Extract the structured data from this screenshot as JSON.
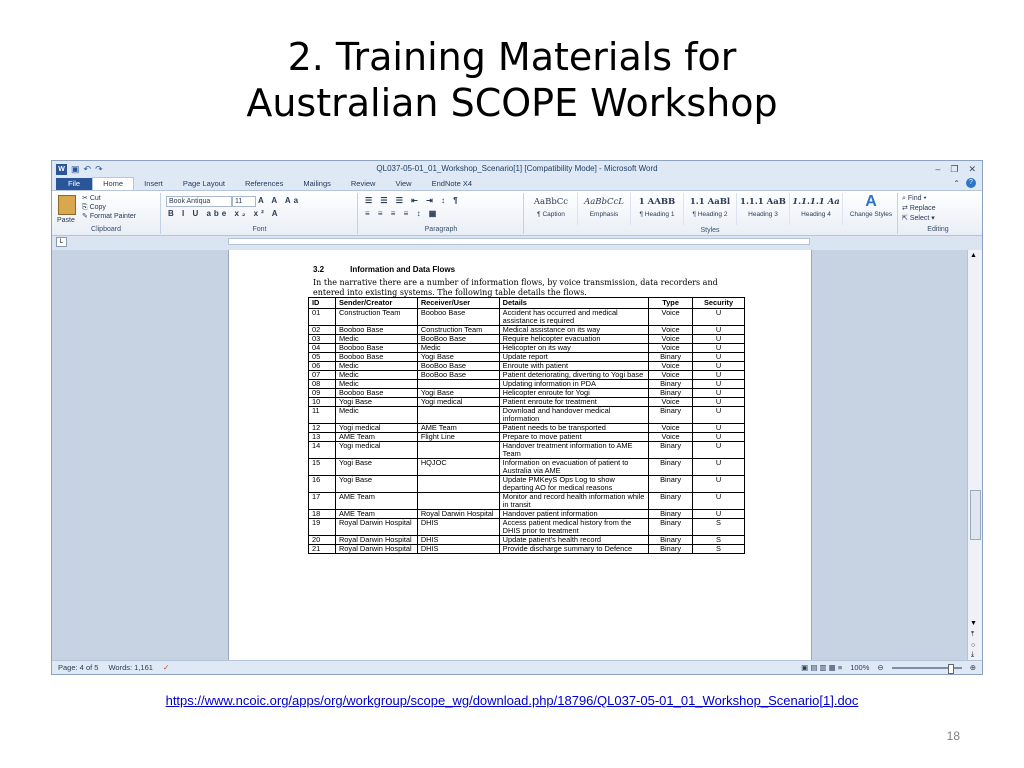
{
  "slide": {
    "title_line1": "2. Training Materials for",
    "title_line2": "Australian SCOPE Workshop",
    "link": "https://www.ncoic.org/apps/org/workgroup/scope_wg/download.php/18796/QL037-05-01_01_Workshop_Scenario[1].doc",
    "page_number": "18"
  },
  "window": {
    "title": "QL037-05-01_01_Workshop_Scenario[1] [Compatibility Mode] - Microsoft Word",
    "icon": "word-icon",
    "tabs": [
      "File",
      "Home",
      "Insert",
      "Page Layout",
      "References",
      "Mailings",
      "Review",
      "View",
      "EndNote X4"
    ],
    "active_tab": "Home"
  },
  "ribbon": {
    "clipboard": {
      "paste": "Paste",
      "cut": "Cut",
      "copy": "Copy",
      "format_painter": "Format Painter",
      "label": "Clipboard"
    },
    "font": {
      "name": "Book Antiqua",
      "size": "11",
      "label": "Font"
    },
    "paragraph": {
      "label": "Paragraph"
    },
    "styles": {
      "items": [
        {
          "sample": "AaBbCc",
          "name": "¶ Caption"
        },
        {
          "sample": "AaBbCcL",
          "name": "Emphasis"
        },
        {
          "sample": "1 AABB",
          "name": "¶ Heading 1"
        },
        {
          "sample": "1.1 AaBl",
          "name": "¶ Heading 2"
        },
        {
          "sample": "1.1.1 AaB",
          "name": "Heading 3"
        },
        {
          "sample": "1.1.1.1 Aa",
          "name": "Heading 4"
        }
      ],
      "change_styles": "Change Styles",
      "label": "Styles"
    },
    "editing": {
      "find": "Find",
      "replace": "Replace",
      "select": "Select",
      "label": "Editing"
    }
  },
  "document": {
    "section_number": "3.2",
    "section_title": "Information and Data Flows",
    "intro": "In the narrative there are a number of information flows, by voice transmission, data recorders and entered into existing systems. The following table details the flows.",
    "table": {
      "headers": [
        "ID",
        "Sender/Creator",
        "Receiver/User",
        "Details",
        "Type",
        "Security"
      ],
      "rows": [
        [
          "01",
          "Construction Team",
          "Booboo Base",
          "Accident has occurred and medical assistance is required",
          "Voice",
          "U"
        ],
        [
          "02",
          "Booboo Base",
          "Construction Team",
          "Medical assistance on its way",
          "Voice",
          "U"
        ],
        [
          "03",
          "Medic",
          "BooBoo Base",
          "Require helicopter evacuation",
          "Voice",
          "U"
        ],
        [
          "04",
          "Booboo Base",
          "Medic",
          "Helicopter on its way",
          "Voice",
          "U"
        ],
        [
          "05",
          "Booboo Base",
          "Yogi Base",
          "Update report",
          "Binary",
          "U"
        ],
        [
          "06",
          "Medic",
          "BooBoo Base",
          "Enroute with patient",
          "Voice",
          "U"
        ],
        [
          "07",
          "Medic",
          "BooBoo Base",
          "Patient deteriorating, diverting to Yogi base",
          "Voice",
          "U"
        ],
        [
          "08",
          "Medic",
          "",
          "Updating information in PDA",
          "Binary",
          "U"
        ],
        [
          "09",
          "Booboo Base",
          "Yogi Base",
          "Helicopter enroute for Yogi",
          "Binary",
          "U"
        ],
        [
          "10",
          "Yogi Base",
          "Yogi medical",
          "Patient enroute for treatment",
          "Voice",
          "U"
        ],
        [
          "11",
          "Medic",
          "",
          "Download and handover medical information",
          "Binary",
          "U"
        ],
        [
          "12",
          "Yogi medical",
          "AME Team",
          "Patient needs to be transported",
          "Voice",
          "U"
        ],
        [
          "13",
          "AME Team",
          "Flight Line",
          "Prepare to move patient",
          "Voice",
          "U"
        ],
        [
          "14",
          "Yogi medical",
          "",
          "Handover treatment information to AME Team",
          "Binary",
          "U"
        ],
        [
          "15",
          "Yogi Base",
          "HQJOC",
          "Information on evacuation of patient to Australia via AME",
          "Binary",
          "U"
        ],
        [
          "16",
          "Yogi Base",
          "",
          "Update PMKeyS Ops Log to show departing AO for medical reasons",
          "Binary",
          "U"
        ],
        [
          "17",
          "AME Team",
          "",
          "Monitor and record health information while in transit",
          "Binary",
          "U"
        ],
        [
          "18",
          "AME Team",
          "Royal Darwin Hospital",
          "Handover patient information",
          "Binary",
          "U"
        ],
        [
          "19",
          "Royal Darwin Hospital",
          "DHIS",
          "Access patient medical history from the DHIS prior to treatment",
          "Binary",
          "S"
        ],
        [
          "20",
          "Royal Darwin Hospital",
          "DHIS",
          "Update patient's health record",
          "Binary",
          "S"
        ],
        [
          "21",
          "Royal Darwin Hospital",
          "DHIS",
          "Provide discharge summary to Defence",
          "Binary",
          "S"
        ]
      ]
    }
  },
  "status": {
    "page": "Page: 4 of 5",
    "words": "Words: 1,161",
    "zoom": "100%"
  }
}
